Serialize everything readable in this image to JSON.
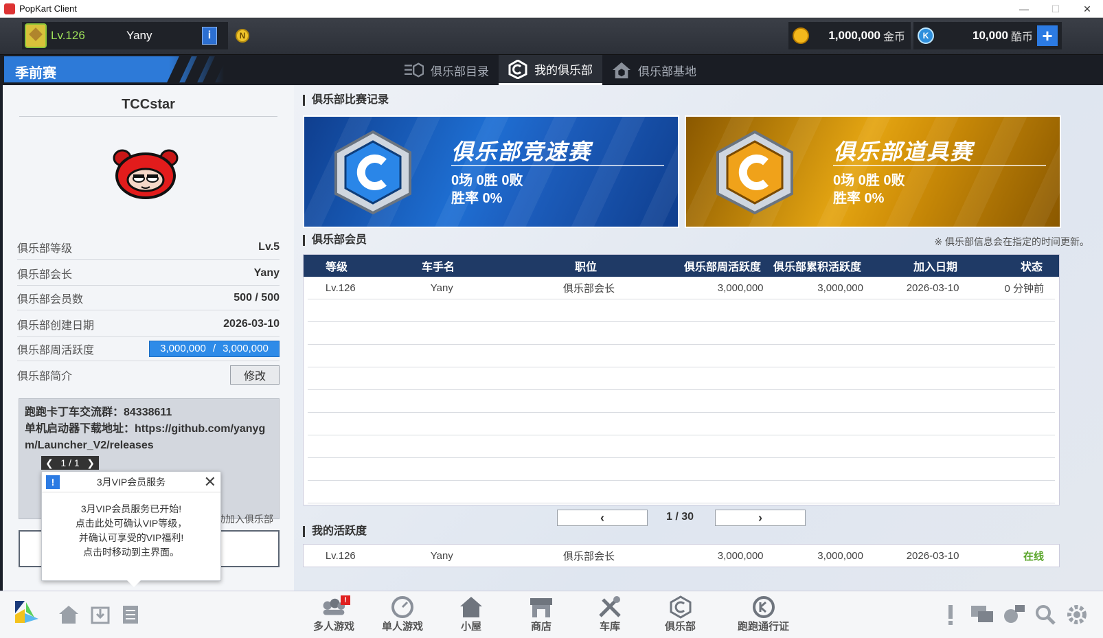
{
  "window": {
    "title": "PopKart Client",
    "minimize_label": "—",
    "maximize_label": "☐",
    "close_label": "✕"
  },
  "user": {
    "level": "Lv.126",
    "name": "Yany",
    "info_label": "i",
    "n_badge": "N"
  },
  "currency": {
    "gold_value": "1,000,000",
    "gold_unit": "金币",
    "k_value": "10,000",
    "k_unit": "酷币",
    "k_label": "K",
    "plus_label": "+"
  },
  "season": {
    "label": "季前赛"
  },
  "tabs": [
    {
      "label": "俱乐部目录",
      "icon": "club-list-icon",
      "active": false
    },
    {
      "label": "我的俱乐部",
      "icon": "my-club-icon",
      "active": true
    },
    {
      "label": "俱乐部基地",
      "icon": "club-base-icon",
      "active": false
    }
  ],
  "club": {
    "name": "TCCstar",
    "stats": [
      {
        "label": "俱乐部等级",
        "value": "Lv.5"
      },
      {
        "label": "俱乐部会长",
        "value": "Yany"
      },
      {
        "label": "俱乐部会员数",
        "value": "500 / 500"
      },
      {
        "label": "俱乐部创建日期",
        "value": "2026-03-10"
      }
    ],
    "weekly_activity_label": "俱乐部周活跃度",
    "weekly_activity_current": "3,000,000",
    "weekly_activity_sep": "/",
    "weekly_activity_max": "3,000,000",
    "weekly_activity_fraction": 1.0,
    "intro_label": "俱乐部简介",
    "edit_label": "修改",
    "intro_text": "跑跑卡丁车交流群：84338611\n单机启动器下载地址：https://github.com/yanygm/Launcher_V2/releases",
    "intro_line1": "跑跑卡丁车交流群：84338611",
    "intro_line2": "单机启动器下载地址：https://github.com/yanyg",
    "intro_line3": "m/Launcher_V2/releases",
    "intro_page": "1 / 1",
    "auto_join_label": "动加入俱乐部"
  },
  "vip_popup": {
    "title": "3月VIP会员服务",
    "line1": "3月VIP会员服务已开始!",
    "line2": "点击此处可确认VIP等级，",
    "line3": "并确认可享受的VIP福利!",
    "line4": "点击时移动到主界面。"
  },
  "records": {
    "section_label": "俱乐部比赛记录",
    "speed": {
      "title": "俱乐部竞速赛",
      "line1": "0场  0胜  0败",
      "line2": "胜率  0%",
      "color": "#1e6fd3"
    },
    "item": {
      "title": "俱乐部道具赛",
      "line1": "0场  0胜  0败",
      "line2": "胜率  0%",
      "color": "#e4a512"
    }
  },
  "members": {
    "section_label": "俱乐部会员",
    "update_note": "※ 俱乐部信息会在指定的时间更新。",
    "columns": [
      "等级",
      "车手名",
      "职位",
      "俱乐部周活跃度",
      "俱乐部累积活跃度",
      "加入日期",
      "状态"
    ],
    "rows": [
      [
        "Lv.126",
        "Yany",
        "俱乐部会长",
        "3,000,000",
        "3,000,000",
        "2026-03-10",
        "0 分钟前"
      ]
    ],
    "page": "1 / 30",
    "prev_label": "‹",
    "next_label": "›"
  },
  "my_activity": {
    "section_label": "我的活跃度",
    "row": [
      "Lv.126",
      "Yany",
      "俱乐部会长",
      "3,000,000",
      "3,000,000",
      "2026-03-10",
      "在线"
    ]
  },
  "bottom_nav": [
    {
      "label": "多人游戏",
      "icon": "multiplayer-icon",
      "badge": "!"
    },
    {
      "label": "单人游戏",
      "icon": "singleplayer-icon"
    },
    {
      "label": "小屋",
      "icon": "house-icon"
    },
    {
      "label": "商店",
      "icon": "shop-icon"
    },
    {
      "label": "车库",
      "icon": "garage-icon"
    },
    {
      "label": "俱乐部",
      "icon": "club-icon"
    },
    {
      "label": "跑跑通行证",
      "icon": "pass-icon"
    }
  ]
}
